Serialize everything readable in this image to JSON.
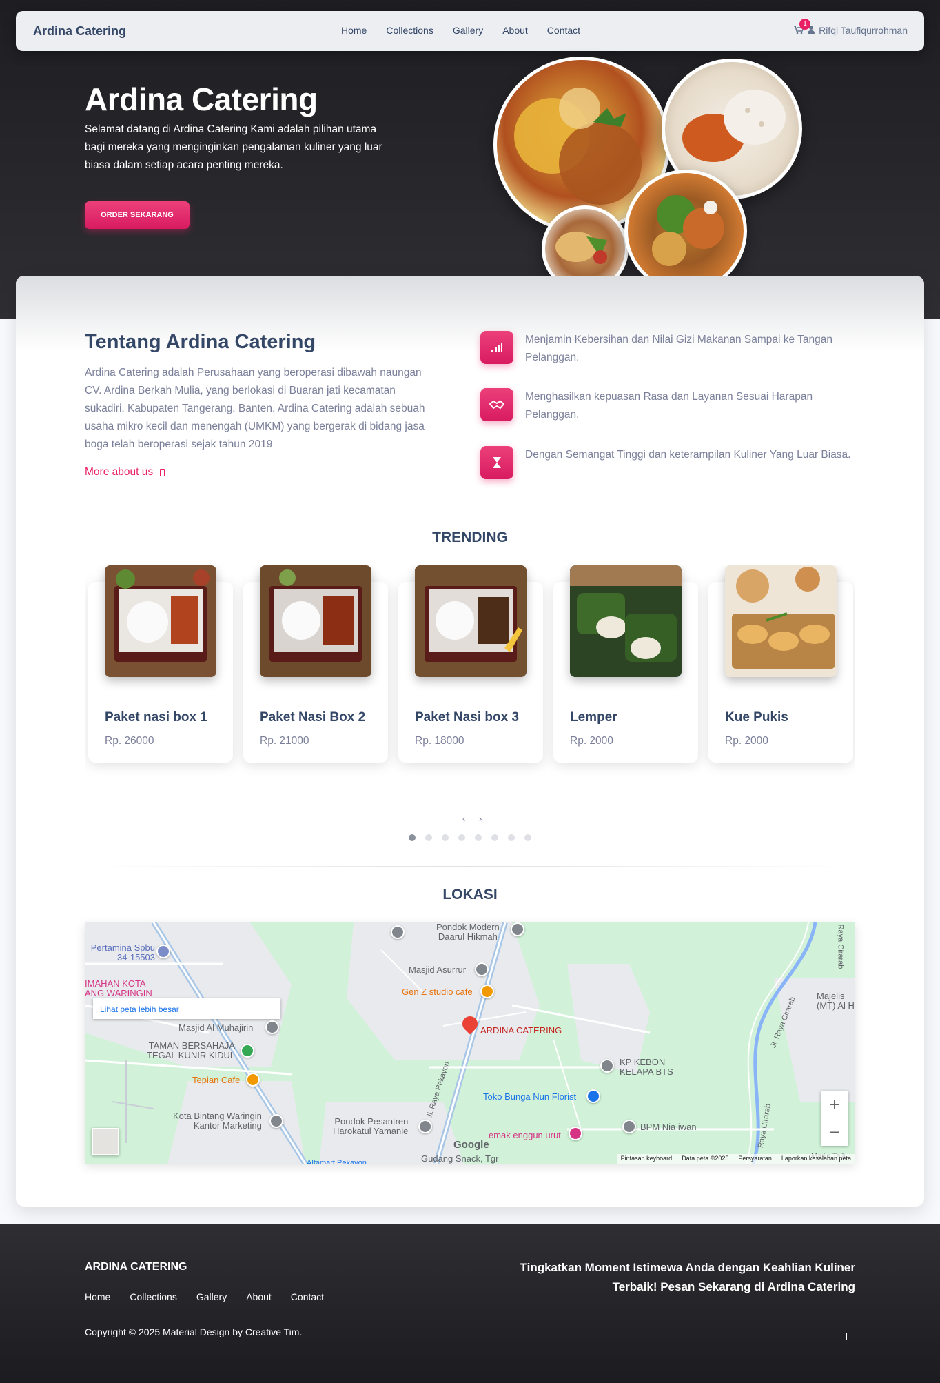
{
  "nav": {
    "brand": "Ardina Catering",
    "links": [
      "Home",
      "Collections",
      "Gallery",
      "About",
      "Contact"
    ],
    "cart_count": "1",
    "user_name": "Rifqi Taufiqurrohman"
  },
  "hero": {
    "title": "Ardina Catering",
    "text": "Selamat datang di Ardina Catering Kami adalah pilihan utama bagi mereka yang menginginkan pengalaman kuliner yang luar biasa dalam setiap acara penting mereka.",
    "button": "ORDER SEKARANG"
  },
  "about": {
    "title": "Tentang Ardina Catering",
    "text": "Ardina Catering adalah Perusahaan yang beroperasi dibawah naungan CV. Ardina Berkah Mulia, yang berlokasi di Buaran jati kecamatan sukadiri, Kabupaten Tangerang, Banten. Ardina Catering adalah sebuah usaha mikro kecil dan menengah (UMKM) yang bergerak di bidang jasa boga telah beroperasi sejak tahun 2019",
    "more_link": "More about us",
    "features": [
      {
        "icon": "chart-icon",
        "text": "Menjamin Kebersihan dan Nilai Gizi Makanan Sampai ke Tangan Pelanggan."
      },
      {
        "icon": "handshake-icon",
        "text": "Menghasilkan kepuasan Rasa dan Layanan Sesuai Harapan Pelanggan."
      },
      {
        "icon": "hourglass-icon",
        "text": "Dengan Semangat Tinggi dan keterampilan Kuliner Yang Luar Biasa."
      }
    ]
  },
  "trending": {
    "title": "TRENDING",
    "products": [
      {
        "name": "Paket nasi box 1",
        "price": "Rp. 26000",
        "image": "nasi-box"
      },
      {
        "name": "Paket Nasi Box 2",
        "price": "Rp. 21000",
        "image": "nasi-box"
      },
      {
        "name": "Paket Nasi box 3",
        "price": "Rp. 18000",
        "image": "nasi-box"
      },
      {
        "name": "Lemper",
        "price": "Rp. 2000",
        "image": "lemper"
      },
      {
        "name": "Kue Pukis",
        "price": "Rp. 2000",
        "image": "kue-pukis"
      }
    ],
    "arrows": "‹ ›",
    "dot_count": 8,
    "active_dot": 0
  },
  "location": {
    "title": "LOKASI",
    "map_link": "Lihat peta lebih besar",
    "labels": {
      "pertamina": "Pertamina Spbu\n34-15503",
      "perumahan": "IMAHAN KOTA\nANG WARINGIN",
      "pondok_modern": "Pondok Modern\nDaarul Hikmah",
      "masjid_asurrur": "Masjid Asurrur",
      "genz": "Gen Z studio cafe",
      "ardina": "ARDINA CATERING",
      "masjid_muhajirin": "Masjid Al Muhajirin",
      "taman": "TAMAN BERSAHAJA\nTEGAL KUNIR KIDUL",
      "tepian": "Tepian Cafe",
      "kp_kebon": "KP KEBON\nKELAPA BTS",
      "toko_bunga": "Toko Bunga Nun Florist",
      "bpm": "BPM Nia iwan",
      "kota_bintang": "Kota Bintang Waringin\nKantor Marketing",
      "pondok_pesantren": "Pondok Pesantren\nHarokatul Yamanie",
      "emak": "emak enggun urut",
      "gudang": "Gudang Snack, Tgr",
      "majelis": "Majelis\n(MT) Al H",
      "road_pekayon": "Jl. Raya Pekayon",
      "road_cirarab": "Jl. Raya Cirarab",
      "road_cirarab2": "Raya Cirarab",
      "road_cirarab3": "Raya Cirarab",
      "alfamart": "Alfamart Pekayon",
      "majelis2": "Majlis Ta'li"
    },
    "google": "Google",
    "footer_items": [
      "Pintasan keyboard",
      "Data peta ©2025",
      "Persyaratan",
      "Laporkan kesalahan peta"
    ],
    "zoom_in": "+",
    "zoom_out": "−"
  },
  "footer": {
    "brand": "ARDINA CATERING",
    "links": [
      "Home",
      "Collections",
      "Gallery",
      "About",
      "Contact"
    ],
    "copyright": "Copyright © 2025 Material Design by Creative Tim.",
    "cta": "Tingkatkan Moment Istimewa Anda dengan Keahlian Kuliner Terbaik! Pesan Sekarang di Ardina Catering"
  },
  "colors": {
    "accent": "#e91e63",
    "text_dark": "#344767",
    "text_muted": "#7b809a"
  }
}
